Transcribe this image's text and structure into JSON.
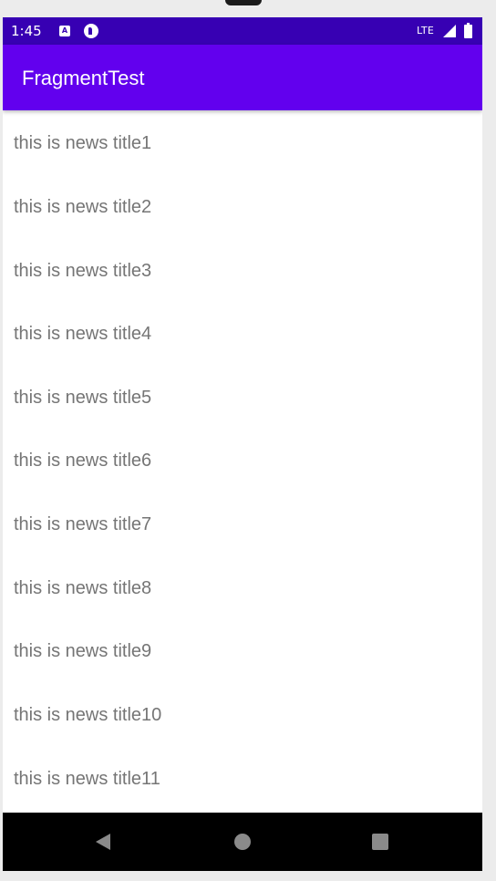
{
  "status_bar": {
    "time": "1:45",
    "network": "LTE",
    "notif_a": "A",
    "color": "#3700b3"
  },
  "app_bar": {
    "title": "FragmentTest",
    "color": "#6200ee"
  },
  "news": {
    "titles": [
      "this is news title1",
      "this is news title2",
      "this is news title3",
      "this is news title4",
      "this is news title5",
      "this is news title6",
      "this is news title7",
      "this is news title8",
      "this is news title9",
      "this is news title10",
      "this is news title11"
    ]
  },
  "icons": {
    "signal": "cell-signal-icon",
    "battery": "battery-icon",
    "back": "back-triangle-icon",
    "home": "home-circle-icon",
    "recents": "recents-square-icon"
  }
}
